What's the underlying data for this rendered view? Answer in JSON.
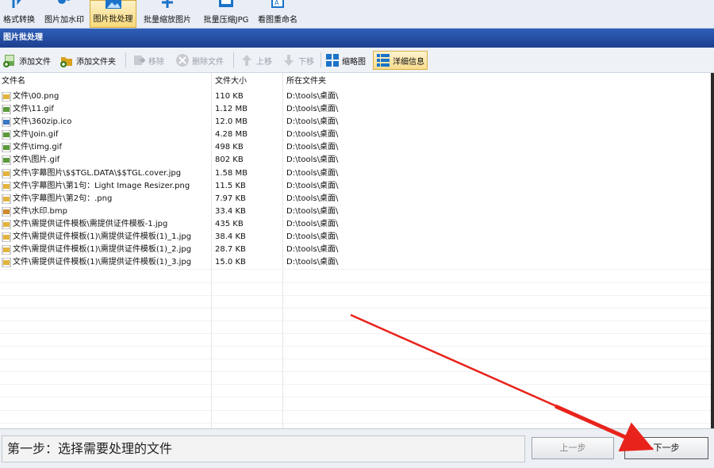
{
  "ribbon": {
    "items": [
      {
        "label": "格式转换",
        "icon": "convert-icon"
      },
      {
        "label": "图片加水印",
        "icon": "watermark-icon"
      },
      {
        "label": "图片批处理",
        "icon": "batch-image-icon",
        "active": true
      },
      {
        "label": "批量缩放图片",
        "icon": "resize-icon"
      },
      {
        "label": "批量压缩JPG",
        "icon": "compress-jpg-icon"
      },
      {
        "label": "看图重命名",
        "icon": "rename-icon"
      }
    ]
  },
  "title": "图片批处理",
  "toolbar": {
    "add_file": "添加文件",
    "add_folder": "添加文件夹",
    "move": "移除",
    "delete_file": "删除文件",
    "move_up": "上移",
    "move_down": "下移",
    "thumbnail": "缩略图",
    "details": "洋细信息"
  },
  "table": {
    "columns": [
      "文件名",
      "文件大小",
      "所在文件夹"
    ],
    "rows": [
      {
        "name": "文件\\00.png",
        "size": "110 KB",
        "folder": "D:\\tools\\桌面\\",
        "type": "png"
      },
      {
        "name": "文件\\11.gif",
        "size": "1.12 MB",
        "folder": "D:\\tools\\桌面\\",
        "type": "gif"
      },
      {
        "name": "文件\\360zip.ico",
        "size": "12.0 MB",
        "folder": "D:\\tools\\桌面\\",
        "type": "ico"
      },
      {
        "name": "文件\\Join.gif",
        "size": "4.28 MB",
        "folder": "D:\\tools\\桌面\\",
        "type": "gif"
      },
      {
        "name": "文件\\timg.gif",
        "size": "498 KB",
        "folder": "D:\\tools\\桌面\\",
        "type": "gif"
      },
      {
        "name": "文件\\图片.gif",
        "size": "802 KB",
        "folder": "D:\\tools\\桌面\\",
        "type": "gif"
      },
      {
        "name": "文件\\字幕图片\\$$TGL.DATA\\$$TGL.cover.jpg",
        "size": "1.58 MB",
        "folder": "D:\\tools\\桌面\\",
        "type": "jpg"
      },
      {
        "name": "文件\\字幕图片\\第1句：Light Image Resizer.png",
        "size": "11.5 KB",
        "folder": "D:\\tools\\桌面\\",
        "type": "png"
      },
      {
        "name": "文件\\字幕图片\\第2句：.png",
        "size": "7.97 KB",
        "folder": "D:\\tools\\桌面\\",
        "type": "png"
      },
      {
        "name": "文件\\水印.bmp",
        "size": "33.4 KB",
        "folder": "D:\\tools\\桌面\\",
        "type": "bmp"
      },
      {
        "name": "文件\\需提供证件模板\\需提供证件模板-1.jpg",
        "size": "435 KB",
        "folder": "D:\\tools\\桌面\\",
        "type": "jpg"
      },
      {
        "name": "文件\\需提供证件模板(1)\\需提供证件模板(1)_1.jpg",
        "size": "38.4 KB",
        "folder": "D:\\tools\\桌面\\",
        "type": "jpg"
      },
      {
        "name": "文件\\需提供证件模板(1)\\需提供证件模板(1)_2.jpg",
        "size": "28.7 KB",
        "folder": "D:\\tools\\桌面\\",
        "type": "jpg"
      },
      {
        "name": "文件\\需提供证件模板(1)\\需提供证件模板(1)_3.jpg",
        "size": "15.0 KB",
        "folder": "D:\\tools\\桌面\\",
        "type": "jpg"
      }
    ]
  },
  "footer": {
    "step_text": "第一步：选择需要处理的文件",
    "prev_label": "上一步",
    "next_label": "下一步"
  },
  "colors": {
    "title_bar": "#1d3f8f",
    "annotation_arrow": "#e8231b"
  }
}
